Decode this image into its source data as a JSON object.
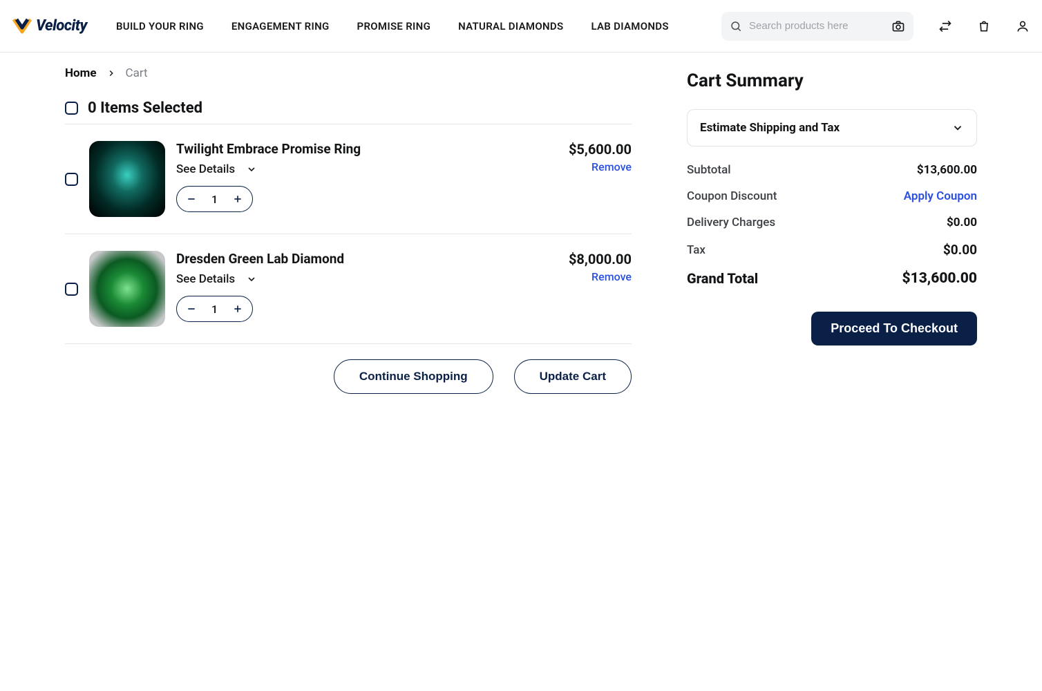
{
  "brand": {
    "name": "Velocity"
  },
  "nav": {
    "build": "BUILD YOUR RING",
    "engagement": "ENGAGEMENT RING",
    "promise": "PROMISE RING",
    "natural": "NATURAL DIAMONDS",
    "lab": "LAB DIAMONDS"
  },
  "search": {
    "placeholder": "Search products here"
  },
  "breadcrumb": {
    "home": "Home",
    "cart": "Cart"
  },
  "selected": {
    "text": "0 Items Selected"
  },
  "items": [
    {
      "title": "Twilight Embrace Promise Ring",
      "details": "See Details",
      "qty": "1",
      "price": "$5,600.00",
      "remove": "Remove"
    },
    {
      "title": "Dresden Green Lab Diamond",
      "details": "See Details",
      "qty": "1",
      "price": "$8,000.00",
      "remove": "Remove"
    }
  ],
  "actions": {
    "continue": "Continue Shopping",
    "update": "Update Cart"
  },
  "summary": {
    "title": "Cart Summary",
    "estimate": "Estimate Shipping and Tax",
    "subtotal_label": "Subtotal",
    "subtotal_value": "$13,600.00",
    "coupon_label": "Coupon Discount",
    "coupon_action": "Apply Coupon",
    "delivery_label": "Delivery Charges",
    "delivery_value": "$0.00",
    "tax_label": "Tax",
    "tax_value": "$0.00",
    "grand_label": "Grand Total",
    "grand_value": "$13,600.00",
    "checkout": "Proceed To Checkout"
  }
}
